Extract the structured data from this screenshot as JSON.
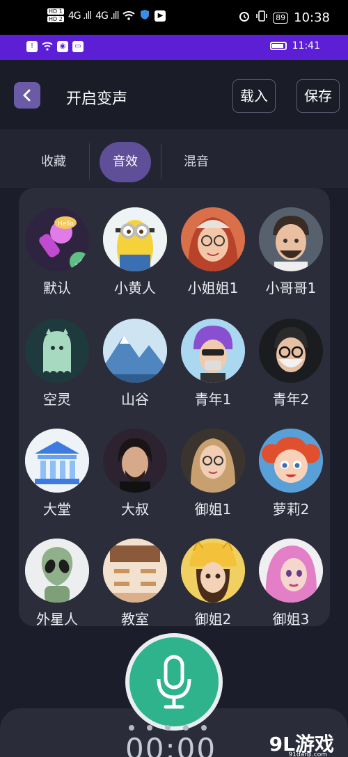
{
  "status_bar": {
    "hd1": "HD 1",
    "hd2": "HD 2",
    "signal1": "4G .ıll",
    "signal2": "4G .ıll",
    "battery": "89",
    "time": "10:38"
  },
  "sub_status": {
    "time": "11:41"
  },
  "header": {
    "back_icon": "chevron-left-icon",
    "title": "开启变声",
    "load_label": "载入",
    "save_label": "保存"
  },
  "tabs": [
    {
      "label": "收藏",
      "active": false
    },
    {
      "label": "音效",
      "active": true
    },
    {
      "label": "混音",
      "active": false
    }
  ],
  "voices": [
    {
      "label": "默认",
      "icon": "microphone-hello-icon",
      "bg": "#3a2b4f",
      "selected": true
    },
    {
      "label": "小黄人",
      "icon": "minion-icon",
      "bg": "#f5d23a"
    },
    {
      "label": "小姐姐1",
      "icon": "girl-avatar-icon",
      "bg": "#d9704a"
    },
    {
      "label": "小哥哥1",
      "icon": "boy-avatar-icon",
      "bg": "#5e6a78"
    },
    {
      "label": "空灵",
      "icon": "ghost-icon",
      "bg": "#274346"
    },
    {
      "label": "山谷",
      "icon": "valley-icon",
      "bg": "#7fb4d8"
    },
    {
      "label": "青年1",
      "icon": "youth-avatar-icon",
      "bg": "#8a4fd0"
    },
    {
      "label": "青年2",
      "icon": "masked-man-icon",
      "bg": "#202226"
    },
    {
      "label": "大堂",
      "icon": "hall-building-icon",
      "bg": "#dfe8f2"
    },
    {
      "label": "大叔",
      "icon": "uncle-avatar-icon",
      "bg": "#3b2b35"
    },
    {
      "label": "御姐1",
      "icon": "lady-avatar-icon",
      "bg": "#6f5a45"
    },
    {
      "label": "萝莉2",
      "icon": "little-girl-icon",
      "bg": "#6ca8d8"
    },
    {
      "label": "外星人",
      "icon": "alien-icon",
      "bg": "#e6e8ea"
    },
    {
      "label": "教室",
      "icon": "classroom-icon",
      "bg": "#f1d9c4"
    },
    {
      "label": "御姐2",
      "icon": "cat-hat-girl-icon",
      "bg": "#e9c23a"
    },
    {
      "label": "御姐3",
      "icon": "pink-hair-girl-icon",
      "bg": "#e27fc6"
    }
  ],
  "mic": {
    "icon": "microphone-icon",
    "timer": "00:00"
  },
  "watermark": {
    "brand": "9L游戏",
    "url": "91danji.com"
  }
}
